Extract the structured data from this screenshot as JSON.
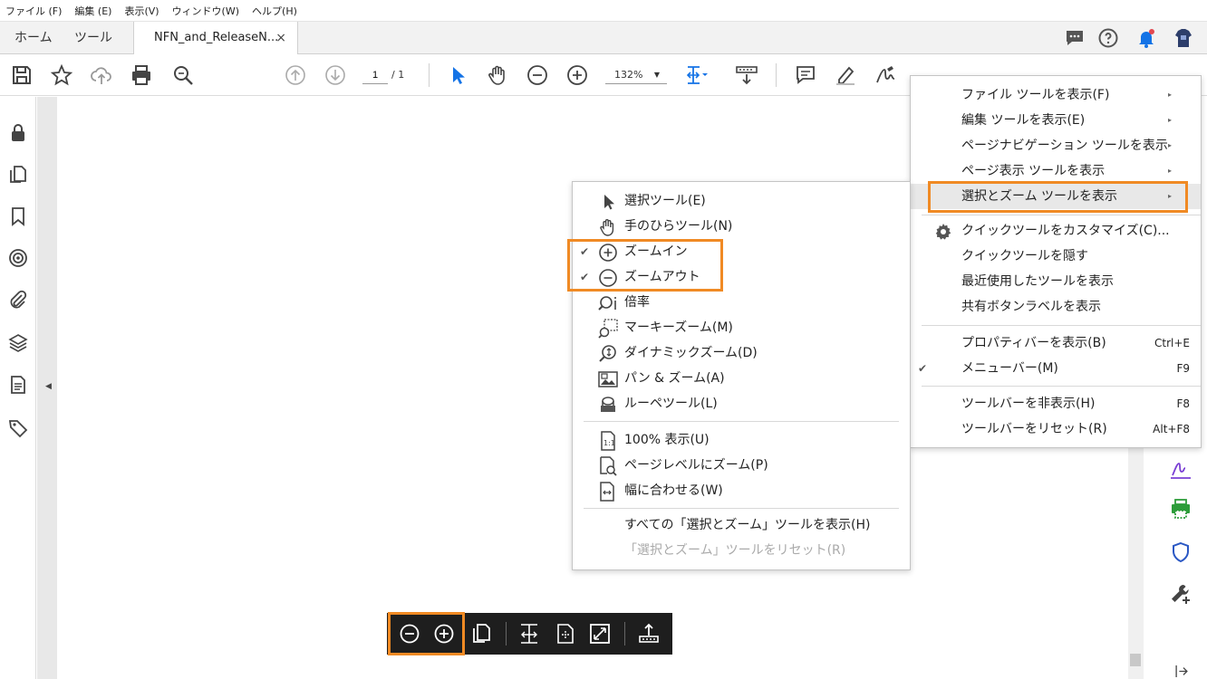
{
  "menubar": {
    "items": [
      "ファイル (F)",
      "編集 (E)",
      "表示(V)",
      "ウィンドウ(W)",
      "ヘルプ(H)"
    ]
  },
  "tabs": {
    "home": "ホーム",
    "tools": "ツール",
    "document": "NFN_and_ReleaseN...",
    "close_glyph": "×"
  },
  "toolbar": {
    "page_current": "1",
    "page_total": "/ 1",
    "zoom": "132%",
    "zoom_caret": "▼"
  },
  "context_menu": {
    "items": [
      {
        "label": "ファイル ツールを表示(F)",
        "arrow": "▸"
      },
      {
        "label": "編集 ツールを表示(E)",
        "arrow": "▸"
      },
      {
        "label": "ページナビゲーション ツールを表示",
        "arrow": "▸"
      },
      {
        "label": "ページ表示 ツールを表示",
        "arrow": "▸"
      },
      {
        "label": "選択とズーム ツールを表示",
        "arrow": "▸"
      },
      {
        "label": "クイックツールをカスタマイズ(C)..."
      },
      {
        "label": "クイックツールを隠す"
      },
      {
        "label": "最近使用したツールを表示"
      },
      {
        "label": "共有ボタンラベルを表示"
      },
      {
        "label": "プロパティバーを表示(B)",
        "shortcut": "Ctrl+E"
      },
      {
        "label": "メニューバー(M)",
        "shortcut": "F9",
        "check": "✔"
      },
      {
        "label": "ツールバーを非表示(H)",
        "shortcut": "F8"
      },
      {
        "label": "ツールバーをリセット(R)",
        "shortcut": "Alt+F8"
      }
    ]
  },
  "sub_menu": {
    "items": [
      {
        "label": "選択ツール(E)"
      },
      {
        "label": "手のひらツール(N)"
      },
      {
        "label": "ズームイン",
        "check": "✔"
      },
      {
        "label": "ズームアウト",
        "check": "✔"
      },
      {
        "label": "倍率"
      },
      {
        "label": "マーキーズーム(M)"
      },
      {
        "label": "ダイナミックズーム(D)"
      },
      {
        "label": "パン & ズーム(A)"
      },
      {
        "label": "ルーペツール(L)"
      },
      {
        "label": "100% 表示(U)"
      },
      {
        "label": "ページレベルにズーム(P)"
      },
      {
        "label": "幅に合わせる(W)"
      },
      {
        "label": "すべての「選択とズーム」ツールを表示(H)"
      },
      {
        "label": "「選択とズーム」ツールをリセット(R)"
      }
    ]
  },
  "colors": {
    "highlight": "#f08a24",
    "accent_blue": "#1473e6",
    "notification_red": "#e34850"
  }
}
